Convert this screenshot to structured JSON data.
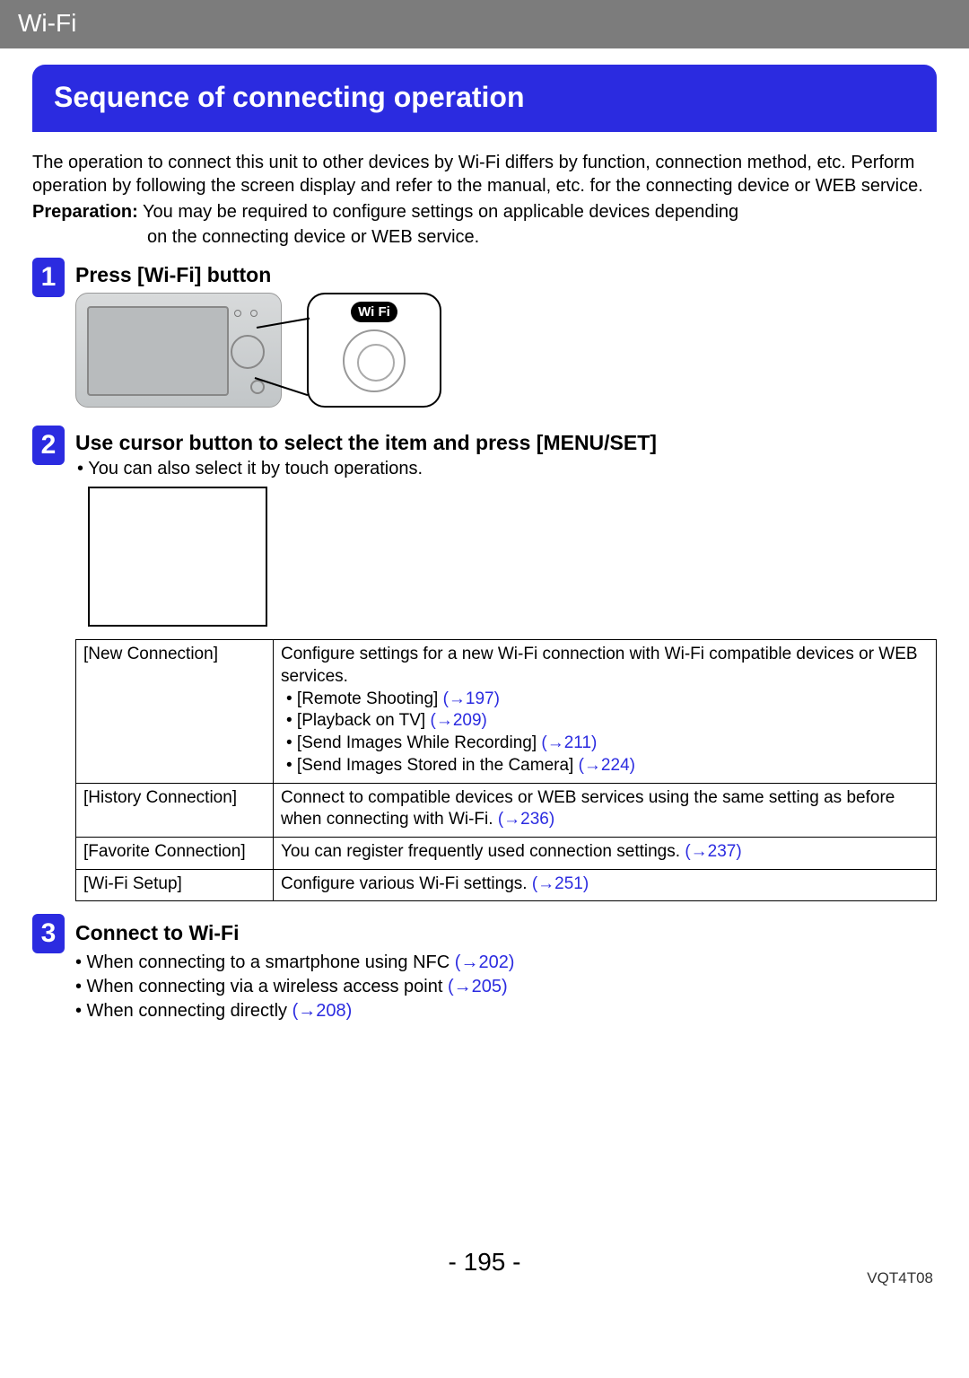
{
  "header": {
    "title": "Wi-Fi"
  },
  "section_title": "Sequence of connecting operation",
  "intro": {
    "p1": "The operation to connect this unit to other devices by Wi-Fi differs by function, connection method, etc. Perform operation by following the screen display and refer to the manual, etc. for the connecting device or WEB service.",
    "prep_label": "Preparation:",
    "prep_text_inline": "You may be required to configure settings on applicable devices depending",
    "prep_text_line2": "on the connecting device or WEB service."
  },
  "steps": {
    "s1": {
      "num": "1",
      "title": "Press [Wi-Fi] button",
      "wifi_badge": "Wi Fi"
    },
    "s2": {
      "num": "2",
      "title": "Use cursor button to select the item and press [MENU/SET]",
      "note": "• You can also select it by touch operations."
    },
    "s3": {
      "num": "3",
      "title": "Connect to Wi-Fi",
      "b1_text": "• When connecting to a smartphone using NFC ",
      "b1_link": "(→202)",
      "b2_text": "• When connecting via a wireless access point ",
      "b2_link": "(→205)",
      "b3_text": "• When connecting directly ",
      "b3_link": "(→208)"
    }
  },
  "table": {
    "r1": {
      "name": "[New Connection]",
      "desc": "Configure settings for a new Wi-Fi connection with Wi-Fi compatible devices or WEB services.",
      "i1_t": "• [Remote Shooting] ",
      "i1_l": "(→197)",
      "i2_t": "• [Playback on TV] ",
      "i2_l": "(→209)",
      "i3_t": "• [Send Images While Recording] ",
      "i3_l": "(→211)",
      "i4_t": "• [Send Images Stored in the Camera] ",
      "i4_l": "(→224)"
    },
    "r2": {
      "name": "[History Connection]",
      "desc_a": "Connect to compatible devices or WEB services using the same setting as before when connecting with Wi-Fi. ",
      "link": "(→236)"
    },
    "r3": {
      "name": "[Favorite Connection]",
      "desc_a": "You can register frequently used connection settings. ",
      "link": "(→237)"
    },
    "r4": {
      "name": "[Wi-Fi Setup]",
      "desc_a": "Configure various Wi-Fi settings. ",
      "link": "(→251)"
    }
  },
  "footer": {
    "page": "- 195 -",
    "doc": "VQT4T08"
  }
}
